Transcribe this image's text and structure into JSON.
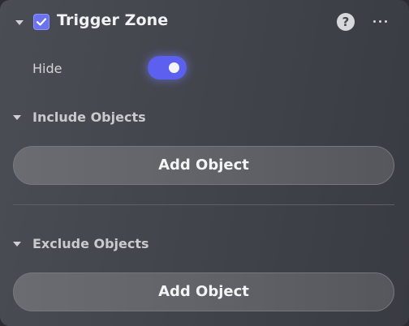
{
  "header": {
    "title": "Trigger Zone",
    "enabled": true,
    "help_glyph": "?",
    "more_icon": "ellipsis-icon"
  },
  "hide": {
    "label": "Hide",
    "value": true
  },
  "include_section": {
    "title": "Include Objects",
    "button_label": "Add Object"
  },
  "exclude_section": {
    "title": "Exclude Objects",
    "button_label": "Add Object"
  },
  "colors": {
    "accent": "#5b61ee",
    "panel": "#44464e"
  }
}
